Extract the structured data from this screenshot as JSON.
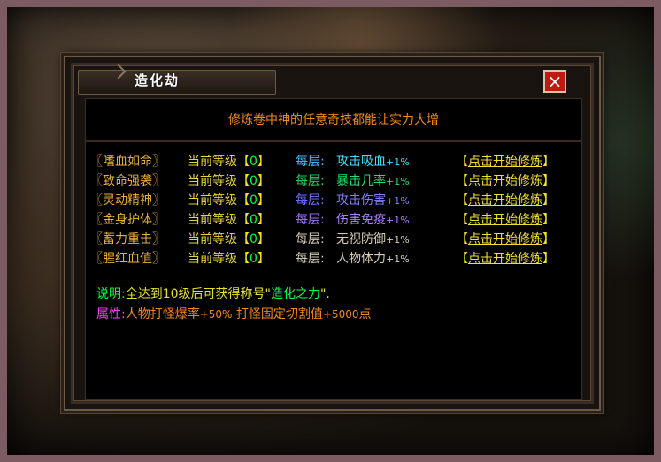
{
  "dialog": {
    "title": "造化劫",
    "close_icon": "×",
    "heading": "修炼卷中神的任意奇技都能让实力大增"
  },
  "skills": [
    {
      "name": "〖嗜血如命〗",
      "level_label": "当前等级",
      "level_open": "【",
      "level": "0",
      "level_close": "】",
      "per_label": "每层:",
      "effect": "攻击吸血",
      "bonus": "+1%",
      "action_open": "【",
      "action": "点击开始修炼",
      "action_close": "】",
      "per_color": "#40b8ff",
      "effect_color": "#40e0ff"
    },
    {
      "name": "〖致命强袭〗",
      "level_label": "当前等级",
      "level_open": "【",
      "level": "0",
      "level_close": "】",
      "per_label": "每层:",
      "effect": "暴击几率",
      "bonus": "+1%",
      "action_open": "【",
      "action": "点击开始修炼",
      "action_close": "】",
      "per_color": "#20d060",
      "effect_color": "#20e070"
    },
    {
      "name": "〖灵动精神〗",
      "level_label": "当前等级",
      "level_open": "【",
      "level": "0",
      "level_close": "】",
      "per_label": "每层:",
      "effect": "攻击伤害",
      "bonus": "+1%",
      "action_open": "【",
      "action": "点击开始修炼",
      "action_close": "】",
      "per_color": "#7070ff",
      "effect_color": "#8080ff"
    },
    {
      "name": "〖金身护体〗",
      "level_label": "当前等级",
      "level_open": "【",
      "level": "0",
      "level_close": "】",
      "per_label": "每层:",
      "effect": "伤害免疫",
      "bonus": "+1%",
      "action_open": "【",
      "action": "点击开始修炼",
      "action_close": "】",
      "per_color": "#a070ff",
      "effect_color": "#b080ff"
    },
    {
      "name": "〖蓄力重击〗",
      "level_label": "当前等级",
      "level_open": "【",
      "level": "0",
      "level_close": "】",
      "per_label": "每层:",
      "effect": "无视防御",
      "bonus": "+1%",
      "action_open": "【",
      "action": "点击开始修炼",
      "action_close": "】",
      "per_color": "#d0c8b0",
      "effect_color": "#d8d0b8"
    },
    {
      "name": "〖腥红血值〗",
      "level_label": "当前等级",
      "level_open": "【",
      "level": "0",
      "level_close": "】",
      "per_label": "每层:",
      "effect": "人物体力",
      "bonus": "+1%",
      "action_open": "【",
      "action": "点击开始修炼",
      "action_close": "】",
      "per_color": "#d0c8b0",
      "effect_color": "#d8d0b8"
    }
  ],
  "footer": {
    "desc_label": "说明:",
    "desc_text": "全达到10级后可获得称号\"",
    "desc_title": "造化之力",
    "desc_end": "\".",
    "attr_label": "属性:",
    "attr_text1": "人物打怪爆率",
    "attr_num1": "+50%",
    "attr_text2": " 打怪固定切割值",
    "attr_num2": "+5000",
    "attr_text3": "点"
  }
}
